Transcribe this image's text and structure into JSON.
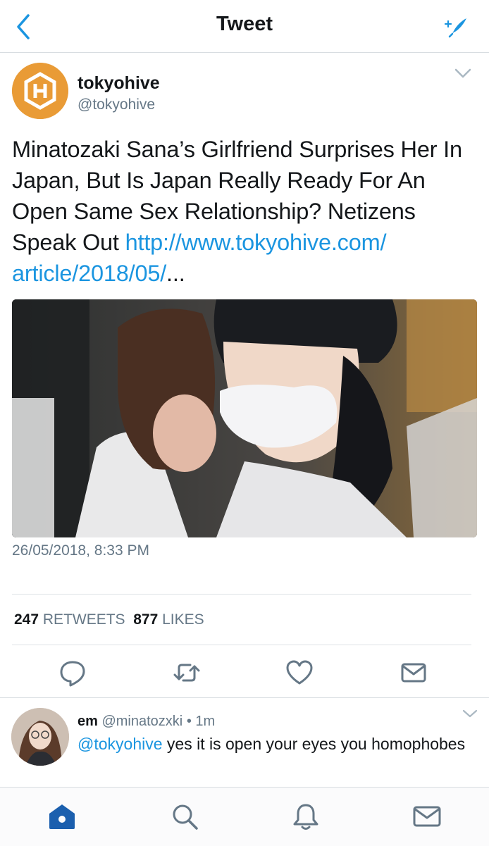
{
  "header": {
    "title": "Tweet",
    "back_icon": "chevron-left-icon",
    "compose_icon": "compose-sparkle-icon"
  },
  "tweet": {
    "author_name": "tokyohive",
    "author_handle": "@tokyohive",
    "text": "Minatozaki Sana’s Girlfriend Surprises Her In Japan, But Is Japan Really Ready For An Open Same Sex Relationship? Netizens Speak Out ",
    "link_text": "http://www.tokyohive.com/ article/2018/05/",
    "ellipsis": "...",
    "timestamp": "26/05/2018, 8:33 PM",
    "retweets_count": "247",
    "retweets_label": "RETWEETS",
    "likes_count": "877",
    "likes_label": "LIKES"
  },
  "reply": {
    "name": "em",
    "handle": "@minatozxki",
    "separator": "•",
    "time": "1m",
    "mention": "@tokyohive",
    "text": " yes it is open your eyes you homophobes"
  },
  "colors": {
    "link": "#1b95e0",
    "brand_orange": "#e99b36",
    "icon_gray": "#657786",
    "home_active": "#1b5fae"
  }
}
